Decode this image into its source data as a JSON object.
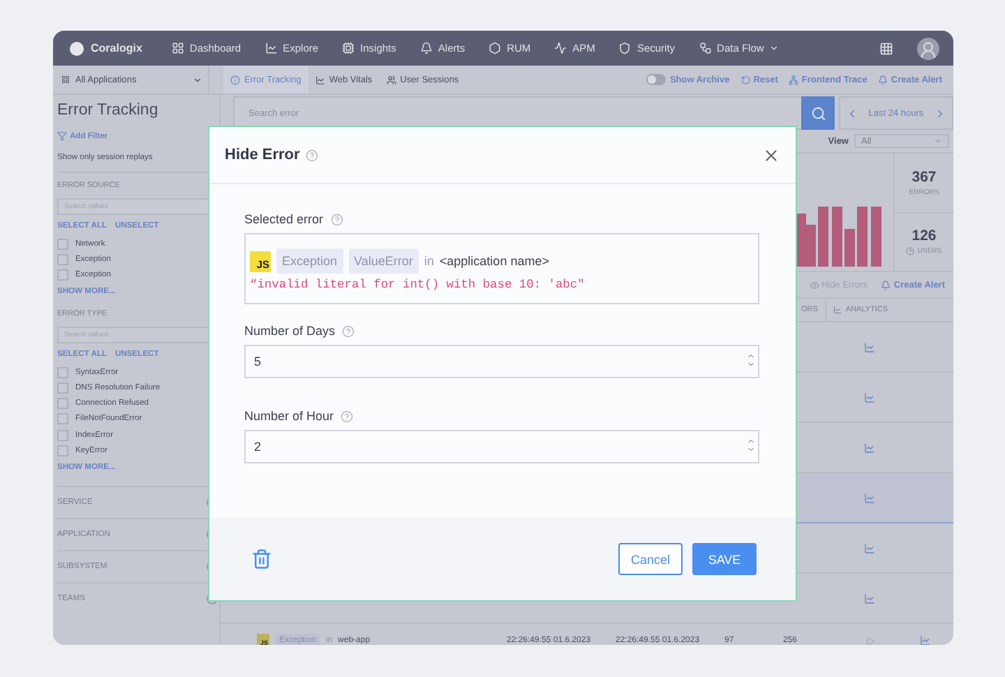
{
  "nav": {
    "brand": "Coralogix",
    "items": [
      {
        "label": "Dashboard",
        "kind": "dashboard",
        "has_menu": false
      },
      {
        "label": "Explore",
        "kind": "explore",
        "has_menu": false
      },
      {
        "label": "Insights",
        "kind": "insights",
        "has_menu": false
      },
      {
        "label": "Alerts",
        "kind": "alerts",
        "has_menu": false
      },
      {
        "label": "RUM",
        "kind": "rum",
        "has_menu": false
      },
      {
        "label": "APM",
        "kind": "apm",
        "has_menu": false
      },
      {
        "label": "Security",
        "kind": "security",
        "has_menu": false
      },
      {
        "label": "Data Flow",
        "kind": "dataflow",
        "has_menu": true
      }
    ]
  },
  "toolbar": {
    "app_select": "All Applications",
    "tabs": [
      {
        "label": "Error Tracking",
        "kind": "info",
        "selected": true
      },
      {
        "label": "Web Vitals",
        "kind": "vitals",
        "selected": false
      },
      {
        "label": "User Sessions",
        "kind": "sessions",
        "selected": false
      }
    ],
    "show_archive": {
      "label": "Show Archive",
      "on": false
    },
    "actions": [
      {
        "label": "Reset",
        "kind": "reset"
      },
      {
        "label": "Frontend Trace",
        "kind": "trace"
      },
      {
        "label": "Create Alert",
        "kind": "alert"
      }
    ]
  },
  "sidebar": {
    "title": "Error Tracking",
    "add_filter": "Add Filter",
    "session_replays": "Show only session replays",
    "groups": [
      {
        "heading": "ERROR SOURCE",
        "search_placeholder": "Search values",
        "select_all": "SELECT ALL",
        "unselect": "UNSELECT",
        "show_more": "SHOW MORE...",
        "options": [
          {
            "label": "Network",
            "checked": false
          },
          {
            "label": "Exception",
            "checked": false
          },
          {
            "label": "Exception",
            "checked": false
          }
        ]
      },
      {
        "heading": "ERROR TYPE",
        "search_placeholder": "Search values",
        "select_all": "SELECT ALL",
        "unselect": "UNSELECT",
        "show_more": "SHOW MORE...",
        "options": [
          {
            "label": "SyntaxError",
            "checked": false
          },
          {
            "label": "DNS Resolution Failure",
            "checked": false
          },
          {
            "label": "Connection Refused",
            "checked": false
          },
          {
            "label": "FileNotFoundError",
            "checked": false
          },
          {
            "label": "IndexError",
            "checked": false
          },
          {
            "label": "KeyError",
            "checked": false
          }
        ]
      }
    ],
    "collapsed": [
      "SERVICE",
      "APPLICATION",
      "SUBSYSTEM",
      "TEAMS"
    ]
  },
  "search": {
    "placeholder": "Search error"
  },
  "time_range": "Last 24 hours",
  "view": {
    "label": "View",
    "placeholder": "All"
  },
  "stats": [
    {
      "value": "367",
      "label": "ERRORS",
      "help": false
    },
    {
      "value": "126",
      "label": "USERS",
      "help": true
    }
  ],
  "list_actions": [
    {
      "label": "Hide Errors",
      "kind": "hide"
    },
    {
      "label": "Create Alert",
      "kind": "alert"
    }
  ],
  "table": {
    "columns": [
      {
        "label": "ORS",
        "icon": false
      },
      {
        "label": "ANALYTICS",
        "icon": true
      }
    ],
    "rows": [
      {
        "kind": "covered",
        "selected": false
      },
      {
        "kind": "covered",
        "selected": false
      },
      {
        "kind": "covered",
        "selected": false
      },
      {
        "kind": "covered",
        "selected": true
      },
      {
        "kind": "covered",
        "selected": false
      },
      {
        "kind": "covered",
        "selected": false
      },
      {
        "kind": "full",
        "selected": false,
        "language": "JS",
        "tag": "Exception",
        "connector": "in",
        "app": "web-app",
        "first_seen": "22:26:49.55 01.6.2023",
        "last_seen": "22:26:49.55 01.6.2023",
        "count": "97",
        "users": "256"
      }
    ]
  },
  "modal": {
    "title": "Hide Error",
    "selected_error": {
      "label": "Selected error",
      "language": "JS",
      "tags": [
        "Exception",
        "ValueError"
      ],
      "connector": "in",
      "app": "<application name>",
      "message": "“invalid literal for int() with base 10: 'abc\""
    },
    "fields": [
      {
        "label": "Number of Days",
        "value": "5"
      },
      {
        "label": "Number of Hour",
        "value": "2"
      }
    ],
    "cancel": "Cancel",
    "save": "SAVE"
  }
}
